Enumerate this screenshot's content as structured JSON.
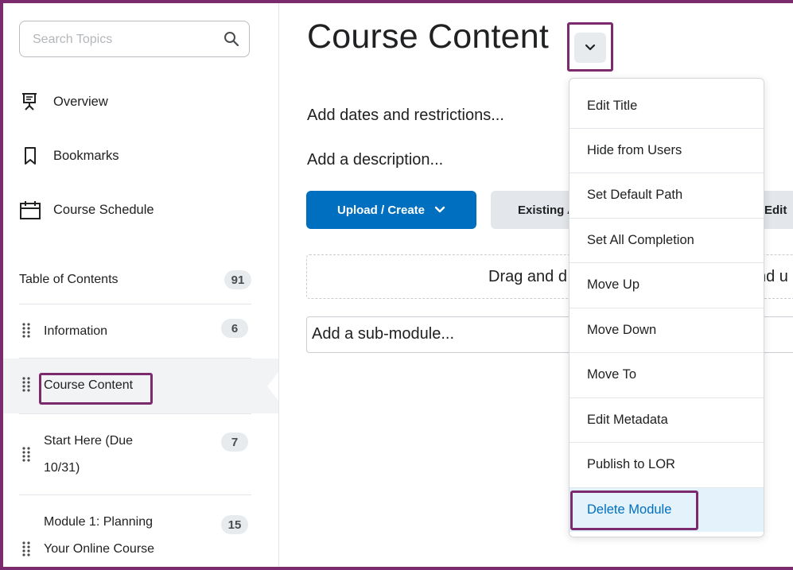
{
  "sidebar": {
    "search": {
      "placeholder": "Search Topics",
      "value": ""
    },
    "nav": [
      {
        "label": "Overview",
        "icon": "presentation-icon"
      },
      {
        "label": "Bookmarks",
        "icon": "bookmark-icon"
      },
      {
        "label": "Course Schedule",
        "icon": "calendar-icon"
      }
    ],
    "toc": {
      "label": "Table of Contents",
      "count": "91",
      "items": [
        {
          "label": "Information",
          "count": "6"
        },
        {
          "label": "Course Content",
          "count": "",
          "selected": true
        },
        {
          "label_lines": [
            "Start Here (Due",
            "10/31)"
          ],
          "count": "7"
        },
        {
          "label_lines": [
            "Module 1: Planning",
            "Your Online Course"
          ],
          "count": "15"
        }
      ]
    }
  },
  "main": {
    "title": "Course Content",
    "add_dates": "Add dates and restrictions...",
    "add_description": "Add a description...",
    "upload_create": "Upload / Create",
    "existing_activities": "Existing Activities",
    "edit": "Edit",
    "dropzone": {
      "left": "Drag and d",
      "right": "nd u"
    },
    "add_submodule": "Add a sub-module..."
  },
  "menu": {
    "items": [
      "Edit Title",
      "Hide from Users",
      "Set Default Path",
      "Set All Completion",
      "Move Up",
      "Move Down",
      "Move To",
      "Edit Metadata",
      "Publish to LOR",
      "Delete Module"
    ],
    "active_item": "Delete Module"
  },
  "colors": {
    "highlight": "#7b2a6e",
    "primary": "#006fbf",
    "menu_active_bg": "#e3f2fb"
  }
}
